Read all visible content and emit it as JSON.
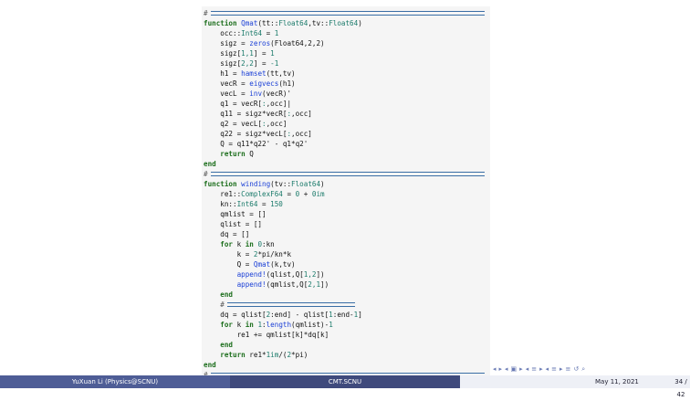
{
  "code": {
    "lines": [
      {
        "name": "comment-line-1",
        "tokens": [
          {
            "c": "t-com",
            "t": "#"
          }
        ]
      },
      {
        "name": "code-line-qmat-def",
        "tokens": [
          {
            "c": "t-kw",
            "t": "function "
          },
          {
            "c": "t-fn",
            "t": "Qmat"
          },
          {
            "c": "t-plain",
            "t": "(tt::"
          },
          {
            "c": "t-ty",
            "t": "Float64"
          },
          {
            "c": "t-plain",
            "t": ",tv::"
          },
          {
            "c": "t-ty",
            "t": "Float64"
          },
          {
            "c": "t-plain",
            "t": ")"
          }
        ]
      },
      {
        "name": "code-line-occ",
        "tokens": [
          {
            "c": "t-plain",
            "t": "    occ::"
          },
          {
            "c": "t-ty",
            "t": "Int64"
          },
          {
            "c": "t-plain",
            "t": " = "
          },
          {
            "c": "t-num",
            "t": "1"
          }
        ]
      },
      {
        "name": "code-line-sigz",
        "tokens": [
          {
            "c": "t-plain",
            "t": "    sigz = "
          },
          {
            "c": "t-fn",
            "t": "zeros"
          },
          {
            "c": "t-plain",
            "t": "(Float64,2,2)"
          }
        ]
      },
      {
        "name": "code-line-sigz11",
        "tokens": [
          {
            "c": "t-plain",
            "t": "    sigz["
          },
          {
            "c": "t-num",
            "t": "1,1"
          },
          {
            "c": "t-plain",
            "t": "] = "
          },
          {
            "c": "t-num",
            "t": "1"
          }
        ]
      },
      {
        "name": "code-line-sigz22",
        "tokens": [
          {
            "c": "t-plain",
            "t": "    sigz["
          },
          {
            "c": "t-num",
            "t": "2,2"
          },
          {
            "c": "t-plain",
            "t": "] = "
          },
          {
            "c": "t-num",
            "t": "-1"
          }
        ]
      },
      {
        "name": "code-line-h1",
        "tokens": [
          {
            "c": "t-plain",
            "t": "    h1 = "
          },
          {
            "c": "t-fn",
            "t": "hamset"
          },
          {
            "c": "t-plain",
            "t": "(tt,tv)"
          }
        ]
      },
      {
        "name": "code-line-vecR",
        "tokens": [
          {
            "c": "t-plain",
            "t": "    vecR = "
          },
          {
            "c": "t-fn",
            "t": "eigvecs"
          },
          {
            "c": "t-plain",
            "t": "(h1)"
          }
        ]
      },
      {
        "name": "code-line-vecL",
        "tokens": [
          {
            "c": "t-plain",
            "t": "    vecL = "
          },
          {
            "c": "t-fn",
            "t": "inv"
          },
          {
            "c": "t-plain",
            "t": "(vecR)'"
          }
        ]
      },
      {
        "name": "code-line-q1",
        "tokens": [
          {
            "c": "t-plain",
            "t": "    q1 = vecR["
          },
          {
            "c": "t-ty",
            "t": ":"
          },
          {
            "c": "t-plain",
            "t": ",occ]|"
          }
        ]
      },
      {
        "name": "code-line-q11",
        "tokens": [
          {
            "c": "t-plain",
            "t": "    q11 = sigz*vecR["
          },
          {
            "c": "t-ty",
            "t": ":"
          },
          {
            "c": "t-plain",
            "t": ",occ]"
          }
        ]
      },
      {
        "name": "code-line-q2",
        "tokens": [
          {
            "c": "t-plain",
            "t": "    q2 = vecL["
          },
          {
            "c": "t-ty",
            "t": ":"
          },
          {
            "c": "t-plain",
            "t": ",occ]"
          }
        ]
      },
      {
        "name": "code-line-q22",
        "tokens": [
          {
            "c": "t-plain",
            "t": "    q22 = sigz*vecL["
          },
          {
            "c": "t-ty",
            "t": ":"
          },
          {
            "c": "t-plain",
            "t": ",occ]"
          }
        ]
      },
      {
        "name": "code-line-Q",
        "tokens": [
          {
            "c": "t-plain",
            "t": "    Q = q11*q22' - q1*q2'"
          }
        ]
      },
      {
        "name": "code-line-return-Q",
        "tokens": [
          {
            "c": "t-kw",
            "t": "    return "
          },
          {
            "c": "t-plain",
            "t": "Q"
          }
        ]
      },
      {
        "name": "code-line-end-1",
        "tokens": [
          {
            "c": "t-kw",
            "t": "end"
          }
        ]
      },
      {
        "name": "comment-line-2",
        "tokens": [
          {
            "c": "t-com",
            "t": "#"
          }
        ]
      },
      {
        "name": "code-line-winding-def",
        "tokens": [
          {
            "c": "t-kw",
            "t": "function "
          },
          {
            "c": "t-fn",
            "t": "winding"
          },
          {
            "c": "t-plain",
            "t": "(tv::"
          },
          {
            "c": "t-ty",
            "t": "Float64"
          },
          {
            "c": "t-plain",
            "t": ")"
          }
        ]
      },
      {
        "name": "code-line-re1",
        "tokens": [
          {
            "c": "t-plain",
            "t": "    re1::"
          },
          {
            "c": "t-ty",
            "t": "ComplexF64"
          },
          {
            "c": "t-plain",
            "t": " = "
          },
          {
            "c": "t-num",
            "t": "0"
          },
          {
            "c": "t-plain",
            "t": " + "
          },
          {
            "c": "t-num",
            "t": "0im"
          }
        ]
      },
      {
        "name": "code-line-kn",
        "tokens": [
          {
            "c": "t-plain",
            "t": "    kn::"
          },
          {
            "c": "t-ty",
            "t": "Int64"
          },
          {
            "c": "t-plain",
            "t": " = "
          },
          {
            "c": "t-num",
            "t": "150"
          }
        ]
      },
      {
        "name": "code-line-qmlist",
        "tokens": [
          {
            "c": "t-plain",
            "t": "    qmlist = []"
          }
        ]
      },
      {
        "name": "code-line-qlist",
        "tokens": [
          {
            "c": "t-plain",
            "t": "    qlist = []"
          }
        ]
      },
      {
        "name": "code-line-dq",
        "tokens": [
          {
            "c": "t-plain",
            "t": "    dq = []"
          }
        ]
      },
      {
        "name": "code-line-for-k",
        "tokens": [
          {
            "c": "t-kw",
            "t": "    for "
          },
          {
            "c": "t-plain",
            "t": "k "
          },
          {
            "c": "t-kw",
            "t": "in "
          },
          {
            "c": "t-num",
            "t": "0"
          },
          {
            "c": "t-plain",
            "t": ":kn"
          }
        ]
      },
      {
        "name": "code-line-k-assign",
        "tokens": [
          {
            "c": "t-plain",
            "t": "        k = "
          },
          {
            "c": "t-num",
            "t": "2"
          },
          {
            "c": "t-plain",
            "t": "*pi/kn*k"
          }
        ]
      },
      {
        "name": "code-line-Q-assign",
        "tokens": [
          {
            "c": "t-plain",
            "t": "        Q = "
          },
          {
            "c": "t-fn",
            "t": "Qmat"
          },
          {
            "c": "t-plain",
            "t": "(k,tv)"
          }
        ]
      },
      {
        "name": "code-line-append-qlist",
        "tokens": [
          {
            "c": "t-fn",
            "t": "        append!"
          },
          {
            "c": "t-plain",
            "t": "(qlist,Q["
          },
          {
            "c": "t-num",
            "t": "1,2"
          },
          {
            "c": "t-plain",
            "t": "])"
          }
        ]
      },
      {
        "name": "code-line-append-qmlist",
        "tokens": [
          {
            "c": "t-fn",
            "t": "        append!"
          },
          {
            "c": "t-plain",
            "t": "(qmlist,Q["
          },
          {
            "c": "t-num",
            "t": "2,1"
          },
          {
            "c": "t-plain",
            "t": "])"
          }
        ]
      },
      {
        "name": "code-line-end-for-1",
        "tokens": [
          {
            "c": "t-kw",
            "t": "    end"
          }
        ]
      },
      {
        "name": "comment-line-3",
        "tokens": [
          {
            "c": "t-com",
            "t": "    #"
          }
        ]
      },
      {
        "name": "code-line-dq-assign",
        "tokens": [
          {
            "c": "t-plain",
            "t": "    dq = qlist["
          },
          {
            "c": "t-num",
            "t": "2"
          },
          {
            "c": "t-plain",
            "t": ":end] - qlist["
          },
          {
            "c": "t-num",
            "t": "1"
          },
          {
            "c": "t-plain",
            "t": ":end-"
          },
          {
            "c": "t-num",
            "t": "1"
          },
          {
            "c": "t-plain",
            "t": "]"
          }
        ]
      },
      {
        "name": "code-line-for-length",
        "tokens": [
          {
            "c": "t-kw",
            "t": "    for "
          },
          {
            "c": "t-plain",
            "t": "k "
          },
          {
            "c": "t-kw",
            "t": "in "
          },
          {
            "c": "t-num",
            "t": "1"
          },
          {
            "c": "t-plain",
            "t": ":"
          },
          {
            "c": "t-fn",
            "t": "length"
          },
          {
            "c": "t-plain",
            "t": "(qmlist)-"
          },
          {
            "c": "t-num",
            "t": "1"
          }
        ]
      },
      {
        "name": "code-line-re1-accum",
        "tokens": [
          {
            "c": "t-plain",
            "t": "        re1 += qmlist[k]*dq[k]"
          }
        ]
      },
      {
        "name": "code-line-end-for-2",
        "tokens": [
          {
            "c": "t-kw",
            "t": "    end"
          }
        ]
      },
      {
        "name": "code-line-return-re1",
        "tokens": [
          {
            "c": "t-kw",
            "t": "    return "
          },
          {
            "c": "t-plain",
            "t": "re1*"
          },
          {
            "c": "t-num",
            "t": "1im"
          },
          {
            "c": "t-plain",
            "t": "/("
          },
          {
            "c": "t-num",
            "t": "2"
          },
          {
            "c": "t-plain",
            "t": "*pi)"
          }
        ]
      },
      {
        "name": "code-line-end-2",
        "tokens": [
          {
            "c": "t-kw",
            "t": "end"
          }
        ]
      },
      {
        "name": "comment-line-4",
        "tokens": [
          {
            "c": "t-com",
            "t": "#"
          }
        ]
      }
    ]
  },
  "nav": {
    "symbols": [
      "◂",
      "▸",
      "◂",
      "▣",
      "▸",
      "◂",
      "≡",
      "▸",
      "◂",
      "≡",
      "▸",
      "≡",
      "↺",
      "⌕"
    ]
  },
  "footer": {
    "author": "YuXuan Li (Physics@SCNU)",
    "title": "CMT.SCNU",
    "date": "May 11, 2021",
    "page": "34 / 42"
  },
  "colors": {
    "footer_left": "#4e5d96",
    "footer_mid": "#3f4a7c",
    "footer_right": "#eef0f6",
    "keyword": "#1c6e1c",
    "function": "#1a3fd6",
    "type": "#1a7a6a"
  }
}
